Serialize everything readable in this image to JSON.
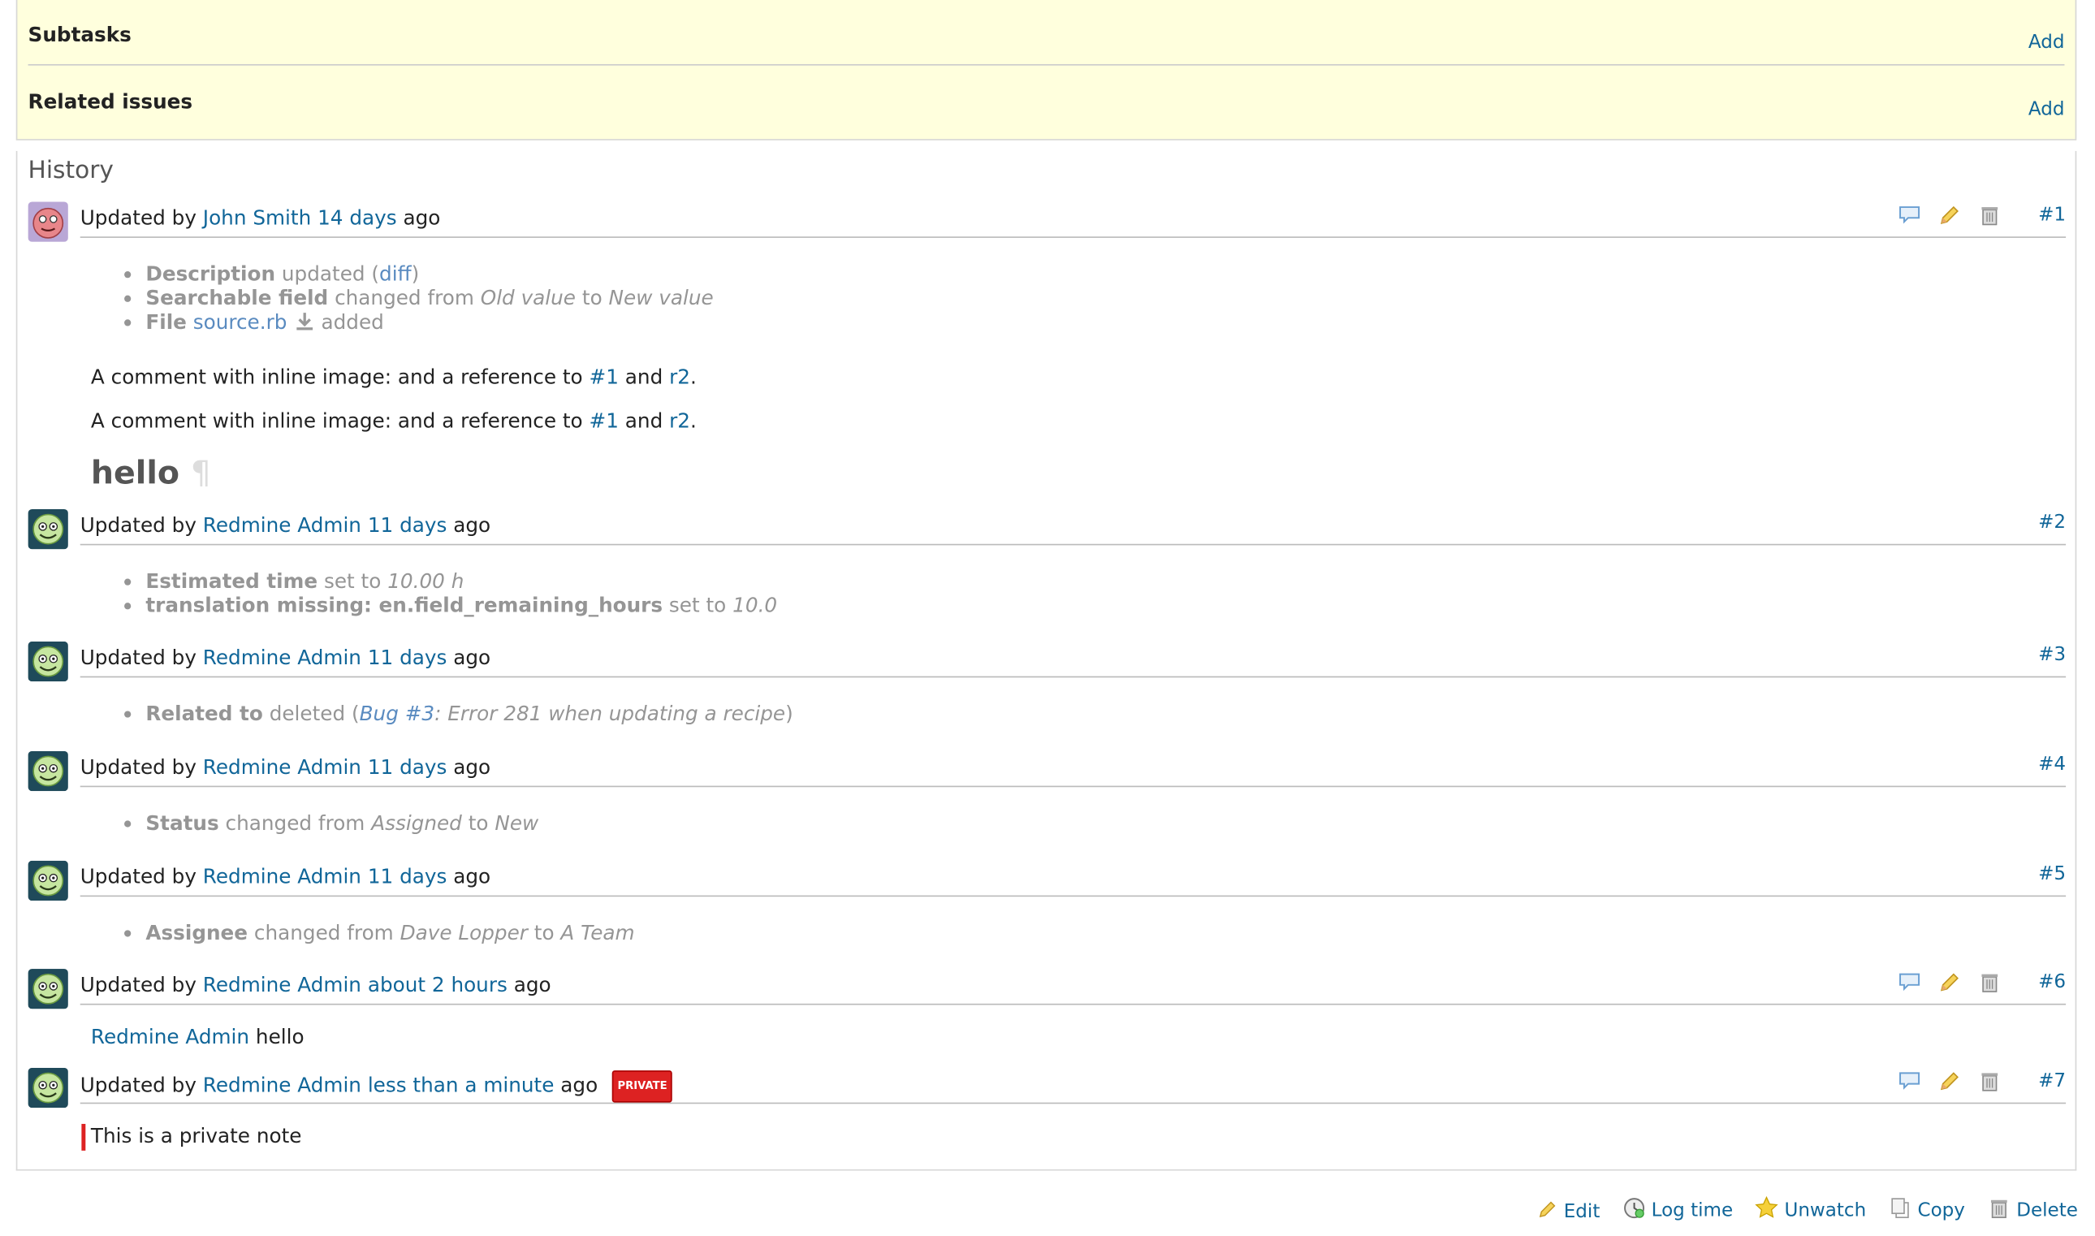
{
  "sections": {
    "subtasks": {
      "title": "Subtasks",
      "add": "Add"
    },
    "related": {
      "title": "Related issues",
      "add": "Add"
    }
  },
  "history": {
    "title": "History",
    "updated_by": "Updated by",
    "ago": "ago",
    "journals": [
      {
        "author": "John Smith",
        "time": "14 days",
        "num": "#1",
        "details": {
          "d1_field": "Description",
          "d1_text": "updated",
          "d1_link": "diff",
          "d2_field": "Searchable field",
          "d2_changed": "changed from",
          "d2_old": "Old value",
          "d2_to": "to",
          "d2_new": "New value",
          "d3_field": "File",
          "d3_link": "source.rb",
          "d3_added": "added"
        },
        "notes": {
          "line_prefix": "A comment with inline image:  and a reference to",
          "ref1": "#1",
          "and": "and",
          "ref2": "r2",
          "period": ".",
          "heading": "hello",
          "pilcrow": "¶"
        }
      },
      {
        "author": "Redmine Admin",
        "time": "11 days",
        "num": "#2",
        "details": {
          "d1_field": "Estimated time",
          "d1_set": "set to",
          "d1_val": "10.00 h",
          "d2_field": "translation missing: en.field_remaining_hours",
          "d2_set": "set to",
          "d2_val": "10.0"
        }
      },
      {
        "author": "Redmine Admin",
        "time": "11 days",
        "num": "#3",
        "details": {
          "field": "Related to",
          "deleted": "deleted",
          "link": "Bug #3",
          "subject": ": Error 281 when updating a recipe"
        }
      },
      {
        "author": "Redmine Admin",
        "time": "11 days",
        "num": "#4",
        "details": {
          "field": "Status",
          "changed": "changed from",
          "old": "Assigned",
          "to": "to",
          "new": "New"
        }
      },
      {
        "author": "Redmine Admin",
        "time": "11 days",
        "num": "#5",
        "details": {
          "field": "Assignee",
          "changed": "changed from",
          "old": "Dave Lopper",
          "to": "to",
          "new": "A Team"
        }
      },
      {
        "author": "Redmine Admin",
        "time": "about 2 hours",
        "num": "#6",
        "notes": {
          "mention": "Redmine Admin",
          "text": "hello"
        }
      },
      {
        "author": "Redmine Admin",
        "time": "less than a minute",
        "num": "#7",
        "badge": "PRIVATE",
        "notes": {
          "text": "This is a private note"
        }
      }
    ]
  },
  "actions": {
    "edit": "Edit",
    "log_time": "Log time",
    "unwatch": "Unwatch",
    "copy": "Copy",
    "delete": "Delete"
  },
  "colors": {
    "link": "#116699",
    "panel_bg": "#ffffdd",
    "private": "#dd2222"
  }
}
